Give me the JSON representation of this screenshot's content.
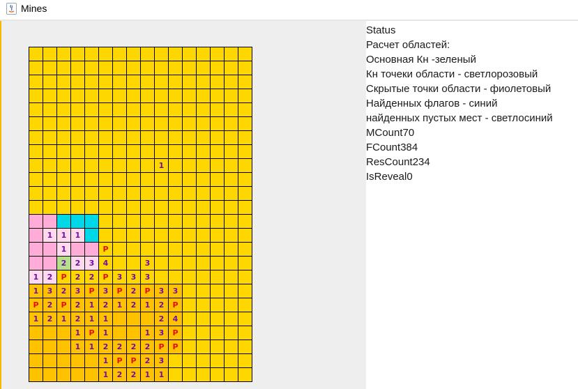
{
  "window": {
    "title": "Mines"
  },
  "colors": {
    "hidden": "#ffd700",
    "revealed": "#ffc200",
    "pink": "#ffadd8",
    "light_pink": "#ffd9ec",
    "cyan": "#00d8e8",
    "green": "#b5e08a",
    "number": "#6b0fa8",
    "flag": "#e01010",
    "red_number": "#d01010"
  },
  "status": {
    "lines": [
      "Status",
      "Расчет областей:",
      "Основная Кн -зеленый",
      "Кн точеки области - светлорозовый",
      "Скрытые точки области - фиолетовый",
      "Найденных флагов - синий",
      "найденных пустых мест - светлосиний",
      "MCount70",
      "FCount384",
      "ResCount234",
      "IsReveal0"
    ]
  },
  "board": {
    "cols": 16,
    "rows": 24,
    "cells": [
      {
        "r": 8,
        "c": 9,
        "t": "1"
      },
      {
        "r": 12,
        "c": 0,
        "bg": "pink"
      },
      {
        "r": 12,
        "c": 1,
        "bg": "pink"
      },
      {
        "r": 12,
        "c": 2,
        "bg": "cyan"
      },
      {
        "r": 12,
        "c": 3,
        "bg": "cyan"
      },
      {
        "r": 12,
        "c": 4,
        "bg": "cyan"
      },
      {
        "r": 13,
        "c": 0,
        "bg": "pink"
      },
      {
        "r": 13,
        "c": 1,
        "bg": "light_pink",
        "t": "1"
      },
      {
        "r": 13,
        "c": 2,
        "bg": "light_pink",
        "t": "1"
      },
      {
        "r": 13,
        "c": 3,
        "bg": "light_pink",
        "t": "1"
      },
      {
        "r": 13,
        "c": 4,
        "bg": "cyan"
      },
      {
        "r": 14,
        "c": 0,
        "bg": "pink"
      },
      {
        "r": 14,
        "c": 1,
        "bg": "pink"
      },
      {
        "r": 14,
        "c": 2,
        "bg": "light_pink",
        "t": "1"
      },
      {
        "r": 14,
        "c": 3,
        "bg": "pink"
      },
      {
        "r": 14,
        "c": 4,
        "bg": "pink"
      },
      {
        "r": 14,
        "c": 5,
        "t": "P",
        "flag": true
      },
      {
        "r": 15,
        "c": 0,
        "bg": "pink"
      },
      {
        "r": 15,
        "c": 1,
        "bg": "pink"
      },
      {
        "r": 15,
        "c": 2,
        "bg": "green",
        "t": "2"
      },
      {
        "r": 15,
        "c": 3,
        "bg": "light_pink",
        "t": "2"
      },
      {
        "r": 15,
        "c": 4,
        "bg": "light_pink",
        "t": "3"
      },
      {
        "r": 15,
        "c": 5,
        "t": "4"
      },
      {
        "r": 15,
        "c": 8,
        "t": "3"
      },
      {
        "r": 16,
        "c": 0,
        "bg": "light_pink",
        "t": "1"
      },
      {
        "r": 16,
        "c": 1,
        "bg": "light_pink",
        "t": "2"
      },
      {
        "r": 16,
        "c": 2,
        "t": "P",
        "flag": true
      },
      {
        "r": 16,
        "c": 3,
        "t": "2"
      },
      {
        "r": 16,
        "c": 4,
        "t": "2"
      },
      {
        "r": 16,
        "c": 5,
        "t": "P",
        "flag": true
      },
      {
        "r": 16,
        "c": 6,
        "t": "3"
      },
      {
        "r": 16,
        "c": 7,
        "t": "3"
      },
      {
        "r": 16,
        "c": 8,
        "t": "3"
      },
      {
        "r": 17,
        "c": 0,
        "t": "1",
        "rev": true
      },
      {
        "r": 17,
        "c": 1,
        "t": "3",
        "rev": true
      },
      {
        "r": 17,
        "c": 2,
        "t": "2",
        "rev": true
      },
      {
        "r": 17,
        "c": 3,
        "t": "3",
        "rev": true
      },
      {
        "r": 17,
        "c": 4,
        "t": "P",
        "flag": true,
        "rev": true
      },
      {
        "r": 17,
        "c": 5,
        "t": "3",
        "rev": true
      },
      {
        "r": 17,
        "c": 6,
        "t": "P",
        "flag": true,
        "rev": true
      },
      {
        "r": 17,
        "c": 7,
        "t": "2",
        "rev": true
      },
      {
        "r": 17,
        "c": 8,
        "t": "P",
        "flag": true,
        "rev": true
      },
      {
        "r": 17,
        "c": 9,
        "t": "3",
        "rev": true
      },
      {
        "r": 17,
        "c": 10,
        "t": "3",
        "rev": true
      },
      {
        "r": 18,
        "c": 0,
        "t": "P",
        "flag": true,
        "rev": true
      },
      {
        "r": 18,
        "c": 1,
        "t": "2",
        "rev": true
      },
      {
        "r": 18,
        "c": 2,
        "t": "P",
        "flag": true,
        "rev": true
      },
      {
        "r": 18,
        "c": 3,
        "t": "2",
        "rev": true
      },
      {
        "r": 18,
        "c": 4,
        "t": "1",
        "rev": true
      },
      {
        "r": 18,
        "c": 5,
        "t": "2",
        "rev": true
      },
      {
        "r": 18,
        "c": 6,
        "t": "1",
        "rev": true
      },
      {
        "r": 18,
        "c": 7,
        "t": "2",
        "rev": true
      },
      {
        "r": 18,
        "c": 8,
        "t": "1",
        "rev": true
      },
      {
        "r": 18,
        "c": 9,
        "t": "2",
        "rev": true
      },
      {
        "r": 18,
        "c": 10,
        "t": "P",
        "flag": true,
        "rev": true
      },
      {
        "r": 19,
        "c": 0,
        "t": "1",
        "rev": true
      },
      {
        "r": 19,
        "c": 1,
        "t": "2",
        "rev": true
      },
      {
        "r": 19,
        "c": 2,
        "t": "1",
        "rev": true
      },
      {
        "r": 19,
        "c": 3,
        "t": "2",
        "rev": true
      },
      {
        "r": 19,
        "c": 4,
        "t": "1",
        "rev": true
      },
      {
        "r": 19,
        "c": 5,
        "t": "1",
        "rev": true
      },
      {
        "r": 19,
        "c": 6,
        "rev": true
      },
      {
        "r": 19,
        "c": 7,
        "rev": true
      },
      {
        "r": 19,
        "c": 8,
        "rev": true
      },
      {
        "r": 19,
        "c": 9,
        "t": "2",
        "rev": true
      },
      {
        "r": 19,
        "c": 10,
        "t": "4",
        "rev": true
      },
      {
        "r": 20,
        "c": 0,
        "rev": true
      },
      {
        "r": 20,
        "c": 1,
        "rev": true
      },
      {
        "r": 20,
        "c": 2,
        "rev": true
      },
      {
        "r": 20,
        "c": 3,
        "t": "1",
        "rev": true
      },
      {
        "r": 20,
        "c": 4,
        "t": "P",
        "flag": true,
        "rev": true
      },
      {
        "r": 20,
        "c": 5,
        "t": "1",
        "rev": true
      },
      {
        "r": 20,
        "c": 6,
        "rev": true
      },
      {
        "r": 20,
        "c": 7,
        "rev": true
      },
      {
        "r": 20,
        "c": 8,
        "t": "1",
        "rev": true
      },
      {
        "r": 20,
        "c": 9,
        "t": "3",
        "rev": true
      },
      {
        "r": 20,
        "c": 10,
        "t": "P",
        "flag": true,
        "rev": true
      },
      {
        "r": 21,
        "c": 0,
        "rev": true
      },
      {
        "r": 21,
        "c": 1,
        "rev": true
      },
      {
        "r": 21,
        "c": 2,
        "rev": true
      },
      {
        "r": 21,
        "c": 3,
        "t": "1",
        "rev": true
      },
      {
        "r": 21,
        "c": 4,
        "t": "1",
        "rev": true
      },
      {
        "r": 21,
        "c": 5,
        "t": "2",
        "rev": true
      },
      {
        "r": 21,
        "c": 6,
        "t": "2",
        "rev": true
      },
      {
        "r": 21,
        "c": 7,
        "t": "2",
        "rev": true
      },
      {
        "r": 21,
        "c": 8,
        "t": "2",
        "rev": true
      },
      {
        "r": 21,
        "c": 9,
        "t": "P",
        "flag": true,
        "rev": true
      },
      {
        "r": 21,
        "c": 10,
        "t": "P",
        "flag": true,
        "rev": true
      },
      {
        "r": 22,
        "c": 0,
        "rev": true
      },
      {
        "r": 22,
        "c": 1,
        "rev": true
      },
      {
        "r": 22,
        "c": 2,
        "rev": true
      },
      {
        "r": 22,
        "c": 3,
        "rev": true
      },
      {
        "r": 22,
        "c": 4,
        "rev": true
      },
      {
        "r": 22,
        "c": 5,
        "t": "1",
        "rev": true
      },
      {
        "r": 22,
        "c": 6,
        "t": "P",
        "flag": true,
        "rev": true
      },
      {
        "r": 22,
        "c": 7,
        "t": "P",
        "flag": true,
        "rev": true
      },
      {
        "r": 22,
        "c": 8,
        "t": "2",
        "rev": true
      },
      {
        "r": 22,
        "c": 9,
        "t": "3",
        "rev": true
      },
      {
        "r": 23,
        "c": 0,
        "rev": true
      },
      {
        "r": 23,
        "c": 1,
        "rev": true
      },
      {
        "r": 23,
        "c": 2,
        "rev": true
      },
      {
        "r": 23,
        "c": 3,
        "rev": true
      },
      {
        "r": 23,
        "c": 4,
        "rev": true
      },
      {
        "r": 23,
        "c": 5,
        "t": "1",
        "rev": true
      },
      {
        "r": 23,
        "c": 6,
        "t": "2",
        "rev": true
      },
      {
        "r": 23,
        "c": 7,
        "t": "2",
        "rev": true
      },
      {
        "r": 23,
        "c": 8,
        "t": "1",
        "rev": true
      },
      {
        "r": 23,
        "c": 9,
        "t": "1",
        "rev": true
      }
    ]
  }
}
